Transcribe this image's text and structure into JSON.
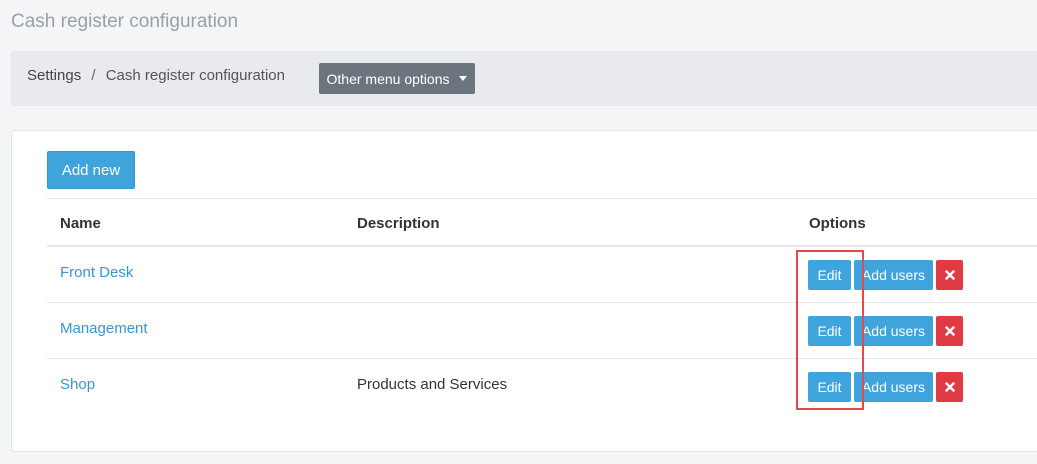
{
  "page": {
    "title": "Cash register configuration"
  },
  "breadcrumb": {
    "root": "Settings",
    "separator": "/",
    "current": "Cash register configuration"
  },
  "toolbar": {
    "menu_label": "Other menu options"
  },
  "card": {
    "add_label": "Add new"
  },
  "table": {
    "headers": {
      "name": "Name",
      "description": "Description",
      "options": "Options"
    },
    "rows": [
      {
        "name": "Front Desk",
        "description": ""
      },
      {
        "name": "Management",
        "description": ""
      },
      {
        "name": "Shop",
        "description": "Products and Services"
      }
    ],
    "edit_label": "Edit",
    "add_users_label": "Add users"
  },
  "icons": {
    "delete": "close-icon"
  },
  "colors": {
    "primary": "#3fa3dc",
    "danger": "#e03a45",
    "secondary": "#6c757d",
    "highlight": "#e04a4a"
  }
}
